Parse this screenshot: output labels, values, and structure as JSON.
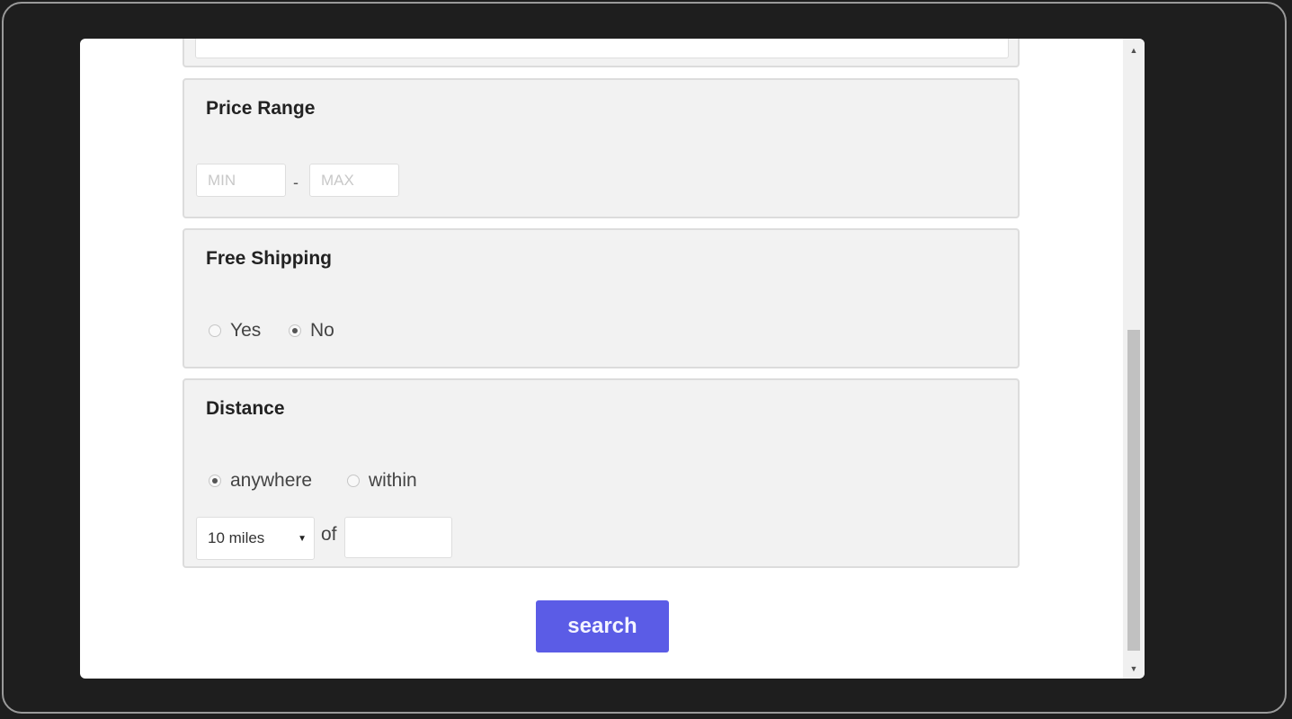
{
  "price_range": {
    "title": "Price Range",
    "min_placeholder": "MIN",
    "max_placeholder": "MAX",
    "separator": "-"
  },
  "free_shipping": {
    "title": "Free Shipping",
    "options": [
      {
        "label": "Yes",
        "checked": false
      },
      {
        "label": "No",
        "checked": true
      }
    ]
  },
  "distance": {
    "title": "Distance",
    "options": [
      {
        "label": "anywhere",
        "checked": true
      },
      {
        "label": "within",
        "checked": false
      }
    ],
    "select_value": "10 miles",
    "of_label": "of",
    "location_value": ""
  },
  "search_button": "search",
  "colors": {
    "accent": "#5b5ce6",
    "panel": "#f2f2f2",
    "frame": "#1e1e1e"
  }
}
